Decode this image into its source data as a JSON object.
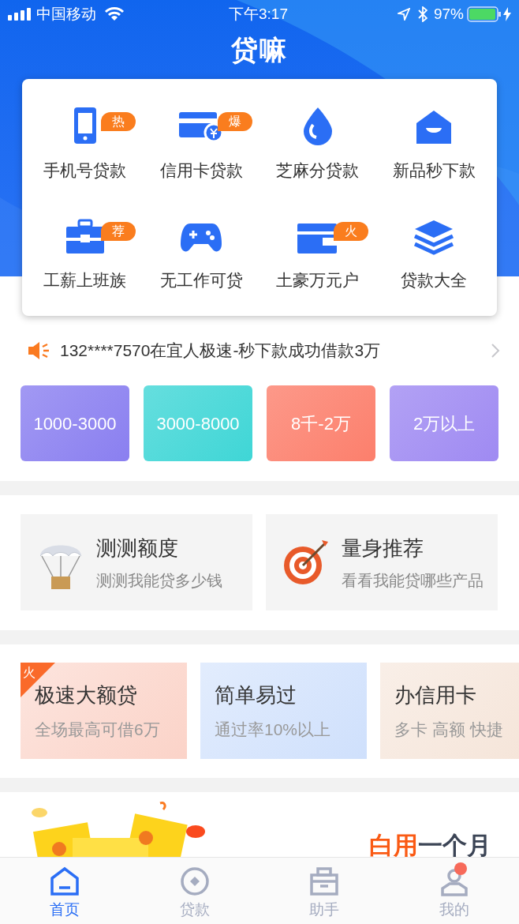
{
  "status_bar": {
    "carrier": "中国移动",
    "time": "下午3:17",
    "battery": "97%"
  },
  "header": {
    "title": "贷嘛"
  },
  "categories": [
    {
      "label": "手机号贷款",
      "badge": "热",
      "kind": "phone"
    },
    {
      "label": "信用卡贷款",
      "badge": "爆",
      "kind": "card"
    },
    {
      "label": "芝麻分贷款",
      "kind": "drop"
    },
    {
      "label": "新品秒下款",
      "kind": "house"
    },
    {
      "label": "工薪上班族",
      "badge": "荐",
      "kind": "briefcase"
    },
    {
      "label": "无工作可贷",
      "kind": "gamepad"
    },
    {
      "label": "土豪万元户",
      "badge": "火",
      "kind": "wallet"
    },
    {
      "label": "贷款大全",
      "kind": "layers"
    }
  ],
  "notice": {
    "text": "132****7570在宜人极速-秒下款成功借款3万"
  },
  "amount_ranges": [
    {
      "label": "1000-3000",
      "color": "#8a7ff0"
    },
    {
      "label": "3000-8000",
      "color": "#3fd6d6"
    },
    {
      "label": "8千-2万",
      "color": "#fc7f6c"
    },
    {
      "label": "2万以上",
      "color": "#9f8af2"
    }
  ],
  "tools": [
    {
      "title": "测测额度",
      "subtitle": "测测我能贷多少钱",
      "kind": "parachute"
    },
    {
      "title": "量身推荐",
      "subtitle": "看看我能贷哪些产品",
      "kind": "target"
    }
  ],
  "promos": [
    {
      "title": "极速大额贷",
      "subtitle": "全场最高可借6万",
      "corner": "火",
      "color": "#fbd3c8"
    },
    {
      "title": "简单易过",
      "subtitle": "通过率10%以上",
      "color": "#cfe0fc"
    },
    {
      "title": "办信用卡",
      "subtitle": "多卡 高额 快捷",
      "color": "#f5e4d8"
    }
  ],
  "banner": {
    "highlight": "白用",
    "rest": "一个月"
  },
  "tab_bar": [
    {
      "label": "首页",
      "selected": true,
      "kind": "home"
    },
    {
      "label": "贷款",
      "selected": false,
      "kind": "loan"
    },
    {
      "label": "助手",
      "selected": false,
      "kind": "assistant"
    },
    {
      "label": "我的",
      "selected": false,
      "kind": "me",
      "badge_dot": true
    }
  ]
}
